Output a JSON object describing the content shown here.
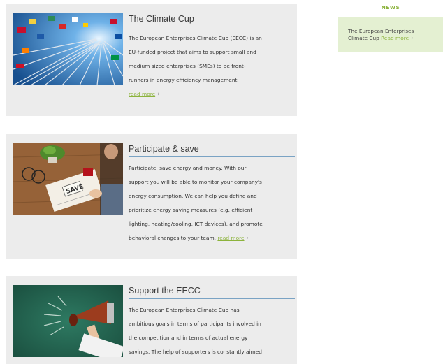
{
  "cards": [
    {
      "title": "The Climate Cup",
      "lines": [
        "The European Enterprises Climate Cup (EECC) is an",
        "EU-funded project that aims to support small and",
        "medium sized enterprises (SMEs) to be front-",
        "runners in energy efficiency management."
      ],
      "read_more": "read more",
      "image": "flags-sky-photo"
    },
    {
      "title": "Participate & save",
      "lines": [
        "Participate, save energy and money. With our",
        "support you will be able to monitor your company's",
        "energy consumption. We can help you define and",
        "prioritize energy saving measures (e.g. efficient",
        "lighting, heating/cooling, ICT devices), and promote"
      ],
      "last_line": "behavioral changes to your team.",
      "read_more": "read more",
      "image": "desk-notebook-save-photo"
    },
    {
      "title": "Support the EECC",
      "lines": [
        "The European Enterprises Climate Cup has",
        "ambitious goals in terms of participants involved in",
        "the competition and in terms of actual energy",
        "savings. The help of supporters is constantly aimed"
      ],
      "image": "megaphone-chalkboard-photo"
    }
  ],
  "news": {
    "heading": "NEWS",
    "line1": "The European Enterprises",
    "line2": "Climate Cup",
    "read_more": "Read more"
  },
  "colors": {
    "accent_green": "#8cb33c",
    "title_rule_blue": "#7aa3c4",
    "card_bg": "#ececec",
    "news_bg": "#e4f0d2"
  },
  "icons": {
    "chevron": "chevron-right-icon"
  }
}
